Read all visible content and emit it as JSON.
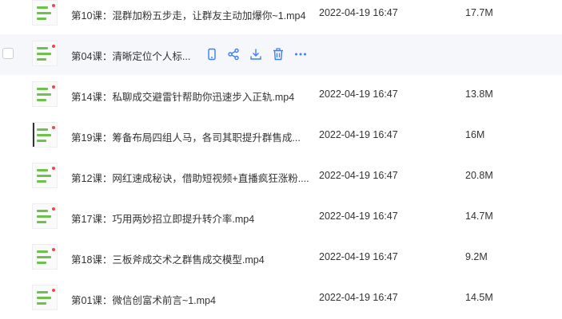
{
  "icons": {
    "phone": "phone-icon",
    "share": "share-icon",
    "download": "download-icon",
    "delete": "trash-icon",
    "more": "more-icon"
  },
  "colors": {
    "accent": "#3b7cff",
    "hover_row": "#f5f7fa"
  },
  "files": [
    {
      "name": "第10课：混群加粉五步走，让群友主动加爆你~1.mp4",
      "date": "2022-04-19 16:47",
      "size": "17.7M"
    },
    {
      "name": "第04课：清晰定位个人标...",
      "date": "",
      "size": ""
    },
    {
      "name": "第14课：私聊成交避雷针帮助你迅速步入正轨.mp4",
      "date": "2022-04-19 16:47",
      "size": "13.8M"
    },
    {
      "name": "第19课：筹备布局四组人马，各司其职提升群售成...",
      "date": "2022-04-19 16:47",
      "size": "16M"
    },
    {
      "name": "第12课：网红速成秘诀，借助短视频+直播疯狂涨粉....",
      "date": "2022-04-19 16:47",
      "size": "20.8M"
    },
    {
      "name": "第17课：巧用两妙招立即提升转介率.mp4",
      "date": "2022-04-19 16:47",
      "size": "14.7M"
    },
    {
      "name": "第18课：三板斧成交术之群售成交模型.mp4",
      "date": "2022-04-19 16:47",
      "size": "9.2M"
    },
    {
      "name": "第01课：微信创富术前言~1.mp4",
      "date": "2022-04-19 16:47",
      "size": "14.5M"
    }
  ]
}
